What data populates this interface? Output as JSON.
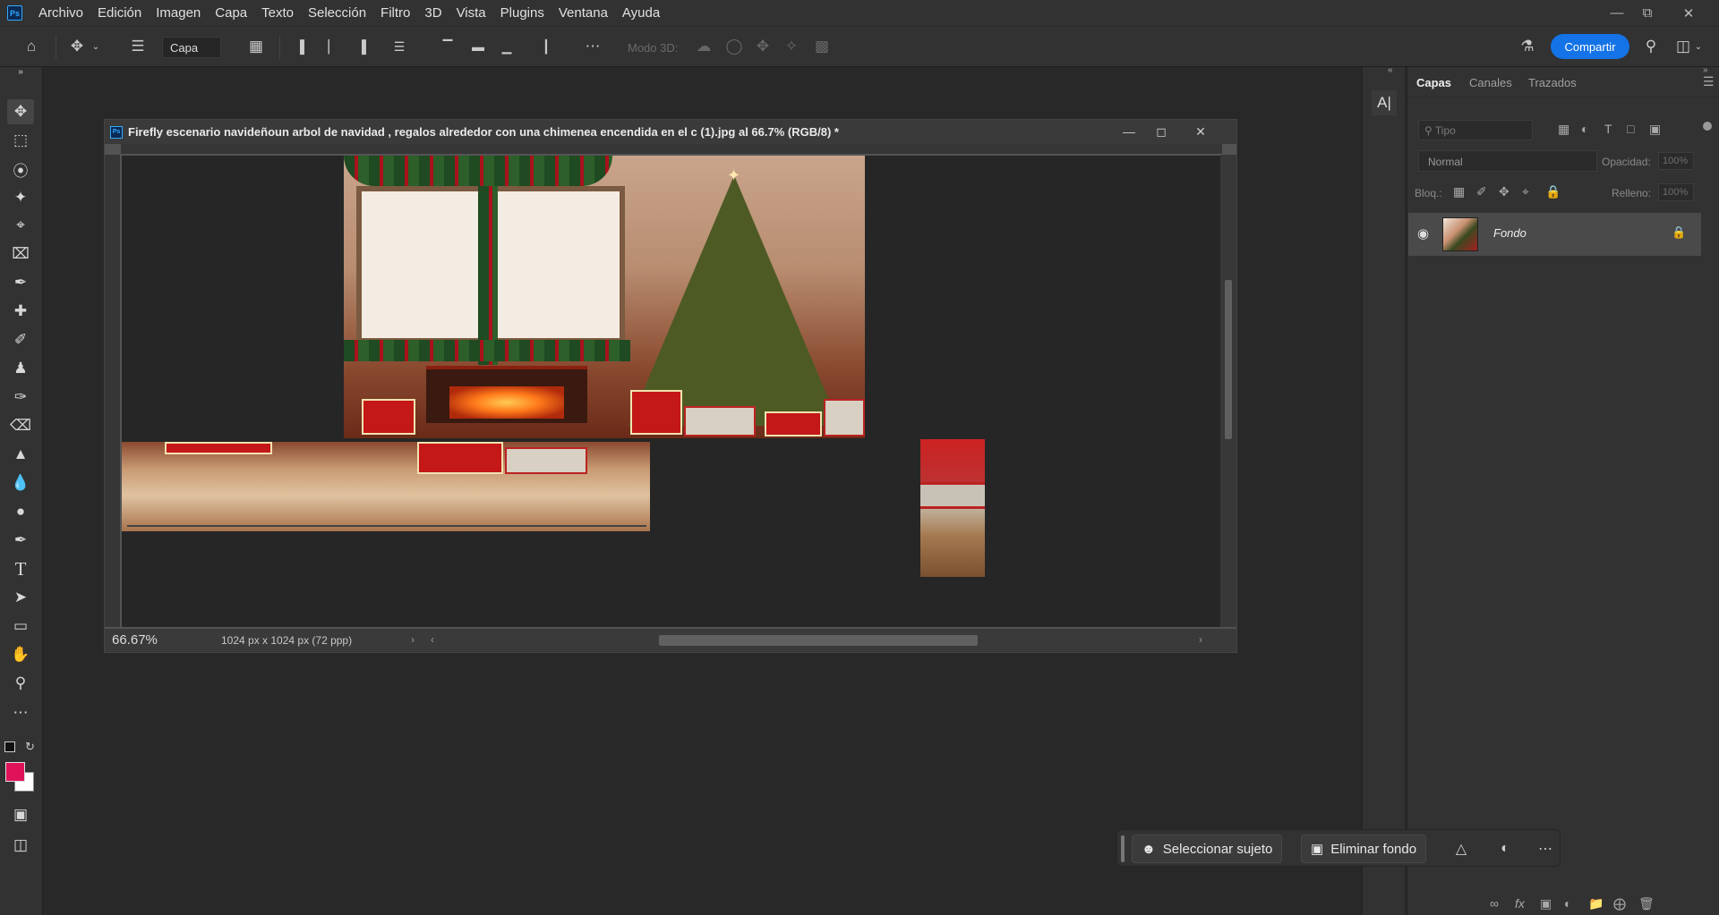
{
  "menu": {
    "items": [
      "Archivo",
      "Edición",
      "Imagen",
      "Capa",
      "Texto",
      "Selección",
      "Filtro",
      "3D",
      "Vista",
      "Plugins",
      "Ventana",
      "Ayuda"
    ]
  },
  "options_bar": {
    "layer_select": "Capa",
    "modo3d_label": "Modo 3D:",
    "share_label": "Compartir"
  },
  "document": {
    "title": "Firefly escenario navideñoun arbol de navidad , regalos alrededor con una chimenea encendida en el c (1).jpg al 66.7% (RGB/8) *",
    "zoom": "66.67%",
    "size_info": "1024 px x 1024 px (72 ppp)",
    "ps_badge": "Ps"
  },
  "panel": {
    "tabs": [
      "Capas",
      "Canales",
      "Trazados"
    ],
    "filter_placeholder": "Tipo",
    "blend_mode": "Normal",
    "opacity_label": "Opacidad:",
    "opacity_value": "100%",
    "lock_label": "Bloq.:",
    "fill_label": "Relleno:",
    "fill_value": "100%",
    "layers": [
      {
        "name": "Fondo",
        "visible": true,
        "locked": true
      }
    ]
  },
  "contextual_bar": {
    "select_subject": "Seleccionar sujeto",
    "remove_background": "Eliminar fondo"
  },
  "colors": {
    "foreground": "#e0135a",
    "background": "#ffffff",
    "accent": "#1473e6"
  }
}
